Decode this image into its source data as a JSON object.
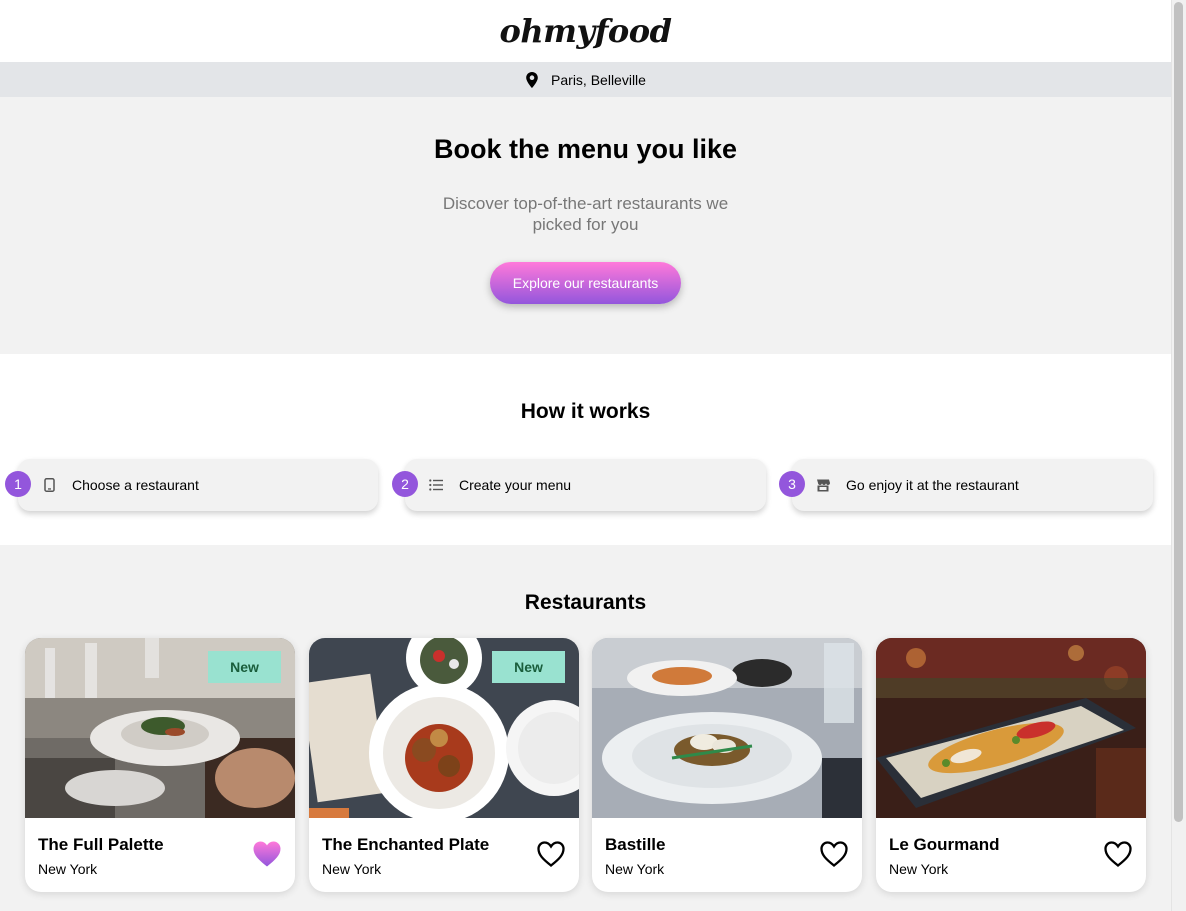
{
  "header": {
    "logo": "ohmyfood"
  },
  "location": {
    "text": "Paris, Belleville",
    "icon": "location-pin-icon"
  },
  "hero": {
    "title": "Book the menu you like",
    "subtitle": "Discover top-of-the-art restaurants we picked for you",
    "cta_label": "Explore our restaurants",
    "cta_gradient": [
      "#ff79da",
      "#9356dc"
    ]
  },
  "how": {
    "title": "How it works",
    "steps": [
      {
        "number": "1",
        "label": "Choose a restaurant",
        "icon": "mobile-phone-icon"
      },
      {
        "number": "2",
        "label": "Create your menu",
        "icon": "list-icon"
      },
      {
        "number": "3",
        "label": "Go enjoy it at the restaurant",
        "icon": "storefront-icon"
      }
    ]
  },
  "restaurants": {
    "title": "Restaurants",
    "items": [
      {
        "name": "The Full Palette",
        "city": "New York",
        "badge": "New",
        "liked": true
      },
      {
        "name": "The Enchanted Plate",
        "city": "New York",
        "badge": "New",
        "liked": false
      },
      {
        "name": "Bastille",
        "city": "New York",
        "badge": "",
        "liked": false
      },
      {
        "name": "Le Gourmand",
        "city": "New York",
        "badge": "",
        "liked": false
      }
    ]
  },
  "colors": {
    "accent": "#9356dc",
    "pink": "#ff79da",
    "badge_bg": "#99e2d0",
    "badge_text": "#1a5e3c",
    "section_gray": "#f2f2f2",
    "location_bar": "#e3e5e8"
  }
}
